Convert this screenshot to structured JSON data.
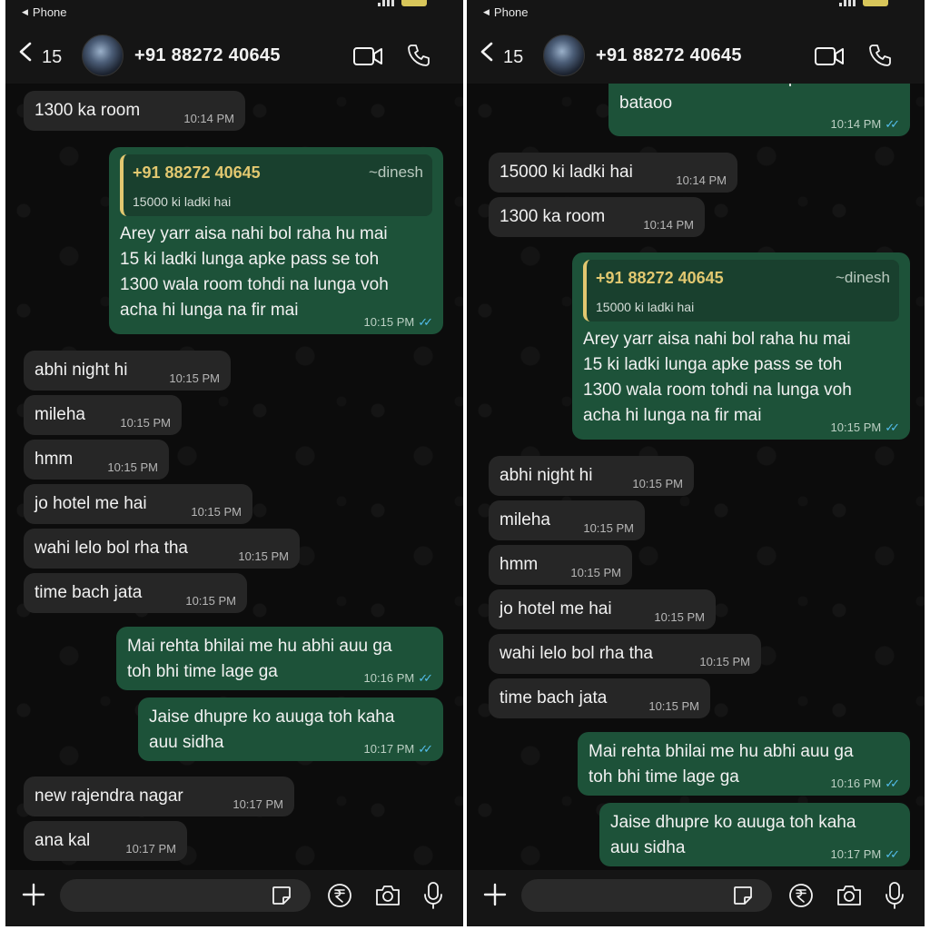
{
  "colors": {
    "incoming": "#262626",
    "outgoing": "#1d5239",
    "read_ticks": "#53bdeb",
    "quote_name": "#e2c870"
  },
  "status": {
    "back_app": "Phone"
  },
  "header": {
    "back_count": "15",
    "contact": "+91 88272 40645"
  },
  "input": {
    "placeholder": ""
  },
  "quote": {
    "name": "+91 88272 40645",
    "alias": "~dinesh",
    "text": "15000 ki ladki hai"
  },
  "icons": [
    "back-arrow-icon",
    "video-call-icon",
    "phone-call-icon",
    "plus-icon",
    "sticker-icon",
    "rupee-icon",
    "camera-icon",
    "mic-icon"
  ],
  "left": {
    "m1": {
      "text": "1300 ka room",
      "time": "10:14 PM"
    },
    "m2": {
      "text": "Arey yarr aisa nahi bol raha hu mai\n15 ki ladki lunga apke pass se toh\n1300 wala room tohdi na lunga voh\nacha hi lunga na fir mai",
      "time": "10:15 PM"
    },
    "m3": {
      "text": "abhi night hi",
      "time": "10:15 PM"
    },
    "m4": {
      "text": "mileha",
      "time": "10:15 PM"
    },
    "m5": {
      "text": "hmm",
      "time": "10:15 PM"
    },
    "m6": {
      "text": "jo hotel me hai",
      "time": "10:15 PM"
    },
    "m7": {
      "text": "wahi lelo bol rha tha",
      "time": "10:15 PM"
    },
    "m8": {
      "text": "time bach jata",
      "time": "10:15 PM"
    },
    "m9": {
      "text": "Mai rehta bhilai me hu abhi auu ga\ntoh bhi time lage ga",
      "time": "10:16 PM"
    },
    "m10": {
      "text": "Jaise dhupre ko auuga toh kaha\nauu sidha",
      "time": "10:17 PM"
    },
    "m11": {
      "text": "new rajendra nagar",
      "time": "10:17 PM"
    },
    "m12": {
      "text": "ana kal",
      "time": "10:17 PM"
    }
  },
  "right": {
    "m0": {
      "text": "Abhi aa raha hu kaha pass auu\nbataoo",
      "time": "10:14 PM"
    },
    "m1": {
      "text": "15000 ki ladki hai",
      "time": "10:14 PM"
    },
    "m2": {
      "text": "1300 ka room",
      "time": "10:14 PM"
    },
    "m3": {
      "text": "Arey yarr aisa nahi bol raha hu mai\n15 ki ladki lunga apke pass se toh\n1300 wala room tohdi na lunga voh\nacha hi lunga na fir mai",
      "time": "10:15 PM"
    },
    "m4": {
      "text": "abhi night hi",
      "time": "10:15 PM"
    },
    "m5": {
      "text": "mileha",
      "time": "10:15 PM"
    },
    "m6": {
      "text": "hmm",
      "time": "10:15 PM"
    },
    "m7": {
      "text": "jo hotel me hai",
      "time": "10:15 PM"
    },
    "m8": {
      "text": "wahi lelo bol rha tha",
      "time": "10:15 PM"
    },
    "m9": {
      "text": "time bach jata",
      "time": "10:15 PM"
    },
    "m10": {
      "text": "Mai rehta bhilai me hu abhi auu ga\ntoh bhi time lage ga",
      "time": "10:16 PM"
    },
    "m11": {
      "text": "Jaise dhupre ko auuga toh kaha\nauu sidha",
      "time": "10:17 PM"
    }
  }
}
